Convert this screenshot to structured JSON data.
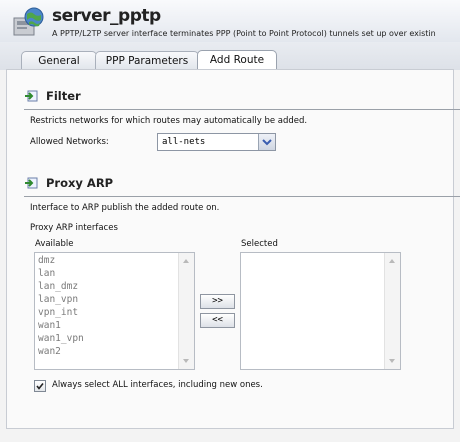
{
  "header": {
    "title": "server_pptp",
    "subtitle": "A PPTP/L2TP server interface terminates PPP (Point to Point Protocol) tunnels set up over existin"
  },
  "tabs": [
    {
      "label": "General",
      "active": false
    },
    {
      "label": "PPP Parameters",
      "active": false
    },
    {
      "label": "Add Route",
      "active": true
    }
  ],
  "filter": {
    "title": "Filter",
    "description": "Restricts networks for which routes may automatically be added.",
    "allowed_networks_label": "Allowed Networks:",
    "allowed_networks_value": "all-nets"
  },
  "proxy_arp": {
    "title": "Proxy ARP",
    "description": "Interface to ARP publish the added route on.",
    "interfaces_label": "Proxy ARP interfaces",
    "available_label": "Available",
    "selected_label": "Selected",
    "available": [
      "dmz",
      "lan",
      "lan_dmz",
      "lan_vpn",
      "vpn_int",
      "wan1",
      "wan1_vpn",
      "wan2"
    ],
    "selected": [],
    "add_button": ">>",
    "remove_button": "<<",
    "always_select_all_label": "Always select ALL interfaces, including new ones.",
    "always_select_all_checked": true
  },
  "icons": {
    "header": "globe-interface-icon",
    "section": "arrow-into-box-icon",
    "dropdown": "chevron-down-icon",
    "check": "checkmark-icon"
  },
  "colors": {
    "header_bg": "#e3e7ee",
    "dropdown_chevron": "#3a5db0",
    "section_icon": "#2f8a2f"
  }
}
